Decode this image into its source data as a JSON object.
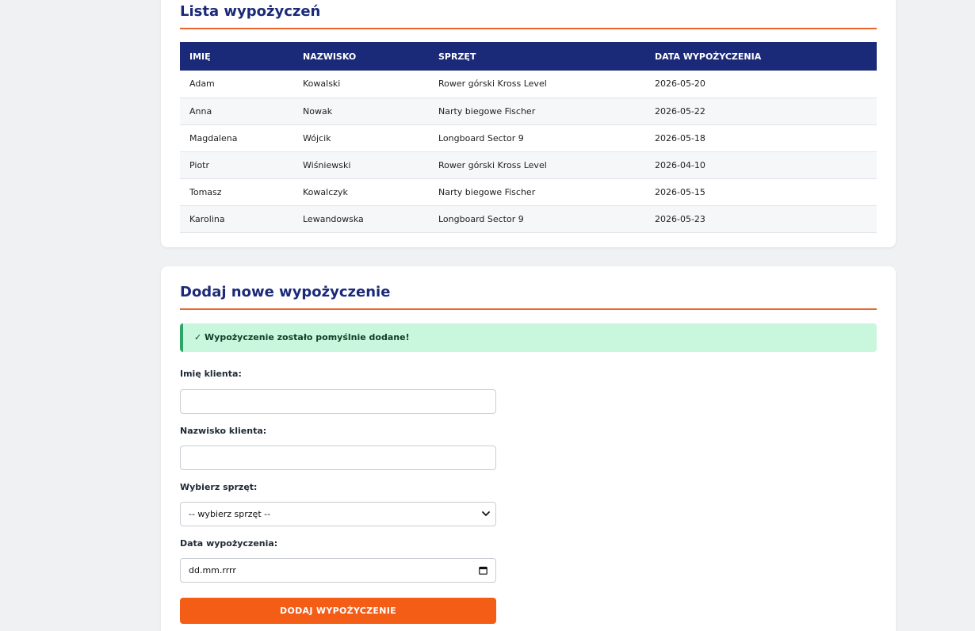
{
  "list_section": {
    "title": "Lista wypożyczeń",
    "headers": [
      "IMIĘ",
      "NAZWISKO",
      "SPRZĘT",
      "DATA WYPOŻYCZENIA"
    ],
    "rows": [
      [
        "Adam",
        "Kowalski",
        "Rower górski Kross Level",
        "2026-05-20"
      ],
      [
        "Anna",
        "Nowak",
        "Narty biegowe Fischer",
        "2026-05-22"
      ],
      [
        "Magdalena",
        "Wójcik",
        "Longboard Sector 9",
        "2026-05-18"
      ],
      [
        "Piotr",
        "Wiśniewski",
        "Rower górski Kross Level",
        "2026-04-10"
      ],
      [
        "Tomasz",
        "Kowalczyk",
        "Narty biegowe Fischer",
        "2026-05-15"
      ],
      [
        "Karolina",
        "Lewandowska",
        "Longboard Sector 9",
        "2026-05-23"
      ]
    ]
  },
  "form_section": {
    "title": "Dodaj nowe wypożyczenie",
    "success_message": "✓ Wypożyczenie zostało pomyślnie dodane!",
    "first_name_label": "Imię klienta:",
    "first_name_value": "",
    "last_name_label": "Nazwisko klienta:",
    "last_name_value": "",
    "equipment_label": "Wybierz sprzęt:",
    "equipment_selected": "-- wybierz sprzęt --",
    "date_label": "Data wypożyczenia:",
    "date_placeholder": "dd.mm.rrrr",
    "submit_label": "DODAJ WYPOŻYCZENIE"
  },
  "colors": {
    "accent": "#f45d16",
    "header_blue": "#1b2a78",
    "success_bg": "#c9f7de",
    "success_border": "#2ea66a"
  },
  "icons": {
    "select_arrow": "chevron-down-icon",
    "date_picker": "calendar-icon"
  }
}
